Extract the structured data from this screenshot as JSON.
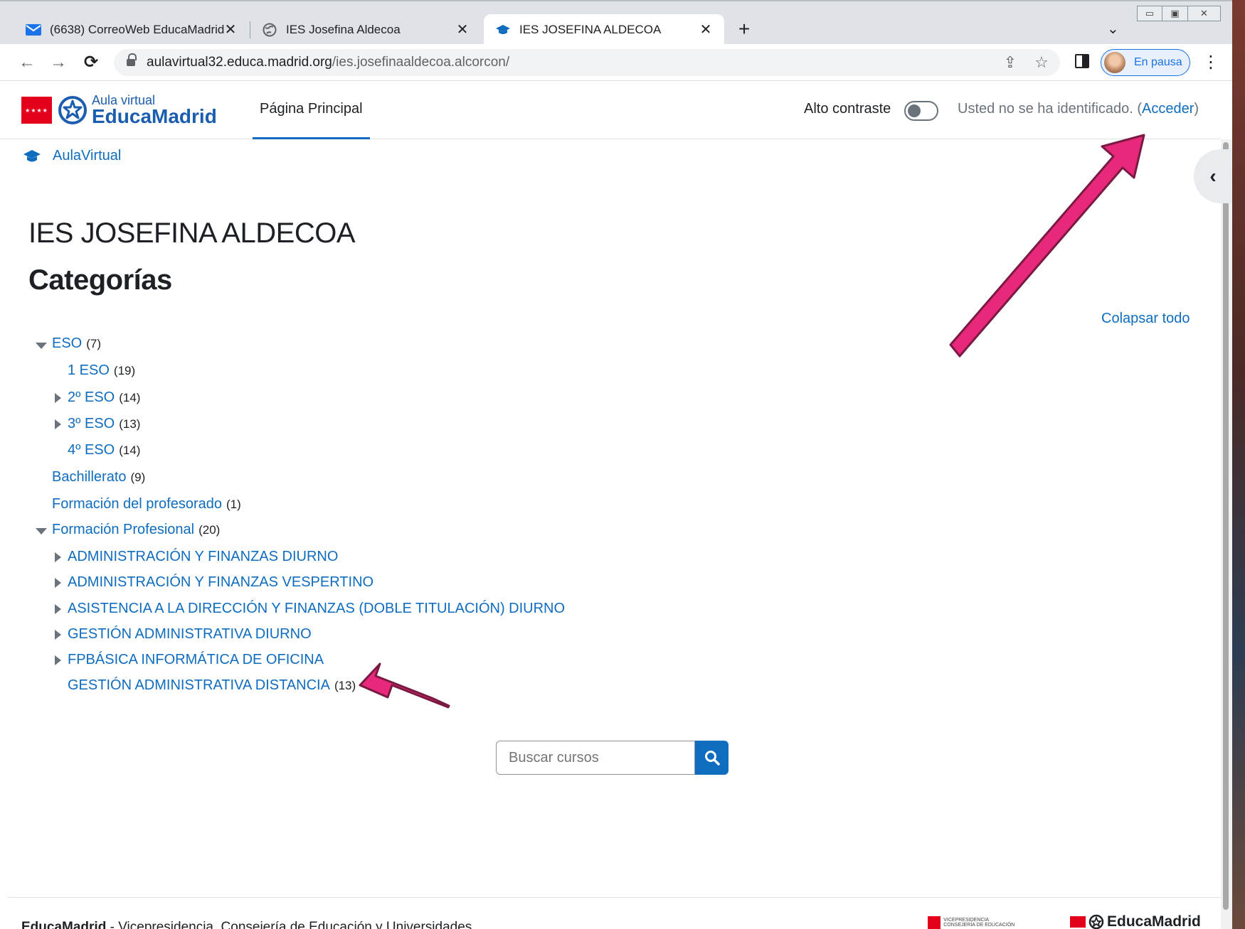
{
  "browser": {
    "tabs": [
      {
        "label": "(6638) CorreoWeb EducaMadrid",
        "icon": "mail-icon"
      },
      {
        "label": "IES Josefina Aldecoa",
        "icon": "globe-icon"
      },
      {
        "label": "IES JOSEFINA ALDECOA",
        "icon": "graduation-cap-icon",
        "active": true
      }
    ],
    "url_host": "aulavirtual32.educa.madrid.org",
    "url_path": "/ies.josefinaaldecoa.alcorcon/",
    "profile_label": "En pausa"
  },
  "site": {
    "logo_small": "Aula virtual",
    "logo_big": "EducaMadrid",
    "nav_home": "Página Principal",
    "contrast_label": "Alto contraste",
    "login_text": "Usted no se ha identificado. (",
    "login_link": "Acceder",
    "login_close": ")"
  },
  "breadcrumb": {
    "label": "AulaVirtual"
  },
  "page": {
    "title": "IES JOSEFINA ALDECOA",
    "subtitle": "Categorías",
    "collapse_all": "Colapsar todo"
  },
  "categories": [
    {
      "label": "ESO",
      "count": "(7)",
      "caret": "down"
    },
    {
      "label": "1 ESO",
      "count": "(19)",
      "caret": "none"
    },
    {
      "label": "2º ESO",
      "count": "(14)",
      "caret": "right"
    },
    {
      "label": "3º ESO",
      "count": "(13)",
      "caret": "right"
    },
    {
      "label": "4º ESO",
      "count": "(14)",
      "caret": "none"
    },
    {
      "label": "Bachillerato",
      "count": "(9)",
      "caret": "none"
    },
    {
      "label": "Formación del profesorado",
      "count": "(1)",
      "caret": "none"
    },
    {
      "label": "Formación Profesional",
      "count": "(20)",
      "caret": "down"
    },
    {
      "label": "ADMINISTRACIÓN Y FINANZAS DIURNO",
      "count": "",
      "caret": "right"
    },
    {
      "label": "ADMINISTRACIÓN Y FINANZAS VESPERTINO",
      "count": "",
      "caret": "right"
    },
    {
      "label": "ASISTENCIA A LA DIRECCIÓN Y FINANZAS (DOBLE TITULACIÓN) DIURNO",
      "count": "",
      "caret": "right"
    },
    {
      "label": "GESTIÓN ADMINISTRATIVA DIURNO",
      "count": "",
      "caret": "right"
    },
    {
      "label": "FPBÁSICA INFORMÁTICA DE OFICINA",
      "count": "",
      "caret": "right"
    },
    {
      "label": "GESTIÓN ADMINISTRATIVA DISTANCIA",
      "count": "(13)",
      "caret": "none"
    }
  ],
  "search": {
    "placeholder": "Buscar cursos"
  },
  "footer": {
    "brand": "EducaMadrid",
    "text": " - Vicepresidencia, Consejería de Educación y Universidades",
    "logo_small": "VICEPRESIDENCIA CONSEJERÍA DE EDUCACIÓN",
    "logo_big": "EducaMadrid"
  },
  "colors": {
    "link": "#0f6cbf",
    "arrow": "#e8287a",
    "brand_red": "#e4001b"
  }
}
